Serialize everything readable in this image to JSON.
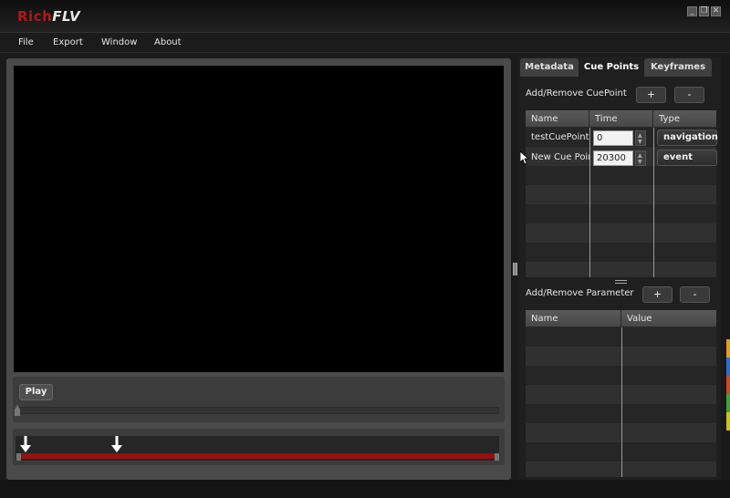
{
  "app": {
    "title_part1": "Rich",
    "title_part2": "FLV"
  },
  "window_controls": [
    "_",
    "❐",
    "✕"
  ],
  "menu": [
    "File",
    "Export",
    "Window",
    "About"
  ],
  "player": {
    "play_label": "Play"
  },
  "tabs": [
    {
      "label": "Metadata",
      "active": false
    },
    {
      "label": "Cue Points",
      "active": true
    },
    {
      "label": "Keyframes",
      "active": false
    }
  ],
  "cuepoints": {
    "section_label": "Add/Remove CuePoint",
    "add_label": "+",
    "remove_label": "-",
    "columns": [
      "Name",
      "Time",
      "Type"
    ],
    "rows": [
      {
        "name": "testCuePoint",
        "time": "0",
        "type": "navigation"
      },
      {
        "name": "New Cue Poir",
        "time": "20300",
        "type": "event"
      }
    ]
  },
  "parameters": {
    "section_label": "Add/Remove Parameter",
    "add_label": "+",
    "remove_label": "-",
    "columns": [
      "Name",
      "Value"
    ]
  },
  "colors": {
    "accent_red": "#9a0e0e",
    "brand_red": "#b01818"
  }
}
